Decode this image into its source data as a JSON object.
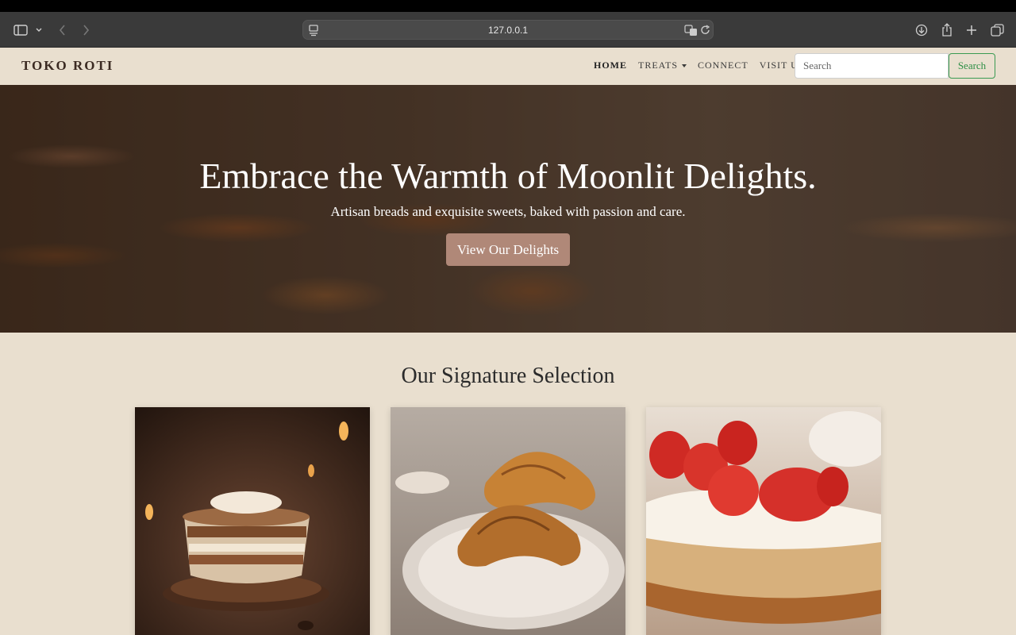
{
  "browser": {
    "url": "127.0.0.1",
    "icons": [
      "sidebar-icon",
      "chevron-down-icon",
      "back-arrow-icon",
      "forward-arrow-icon",
      "site-settings-icon",
      "translate-icon",
      "reload-icon",
      "download-icon",
      "share-icon",
      "new-tab-icon",
      "tab-overview-icon"
    ]
  },
  "navbar": {
    "brand": "TOKO ROTI",
    "links": [
      {
        "label": "HOME",
        "active": true
      },
      {
        "label": "TREATS",
        "dropdown": true
      },
      {
        "label": "CONNECT"
      },
      {
        "label": "VISIT US"
      }
    ],
    "search": {
      "placeholder": "Search",
      "button_label": "Search"
    }
  },
  "hero": {
    "title": "Embrace the Warmth of Moonlit Delights.",
    "subtitle": "Artisan breads and exquisite sweets, baked with passion and care.",
    "cta_label": "View Our Delights"
  },
  "signature": {
    "title": "Our Signature Selection",
    "cards": [
      {
        "image": "tiramisu-cup-image"
      },
      {
        "image": "croissant-plate-image"
      },
      {
        "image": "strawberry-cream-toast-image"
      }
    ]
  },
  "colors": {
    "page_bg": "#e9dfcf",
    "brand_text": "#3b2a22",
    "search_accent": "#2f8f47",
    "cta_bg": "#b08878"
  }
}
